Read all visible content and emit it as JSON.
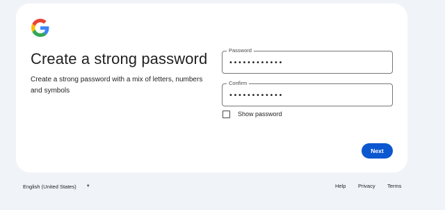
{
  "logo": {
    "icon": "google-g-icon",
    "colors": [
      "#4285F4",
      "#EA4335",
      "#FBBC05",
      "#34A853"
    ]
  },
  "heading": {
    "title": "Create a strong password",
    "subtitle": "Create a strong password with a mix of letters, numbers and symbols"
  },
  "form": {
    "password": {
      "label": "Password",
      "value": "••••••••••••"
    },
    "confirm": {
      "label": "Confirm",
      "value": "••••••••••••"
    },
    "show_password": {
      "label": "Show password",
      "checked": false
    }
  },
  "actions": {
    "next_label": "Next"
  },
  "footer": {
    "language": "English (United States)",
    "links": {
      "help": "Help",
      "privacy": "Privacy",
      "terms": "Terms"
    }
  },
  "colors": {
    "background": "#f0f4f9",
    "card": "#ffffff",
    "primary": "#0b57d0"
  }
}
